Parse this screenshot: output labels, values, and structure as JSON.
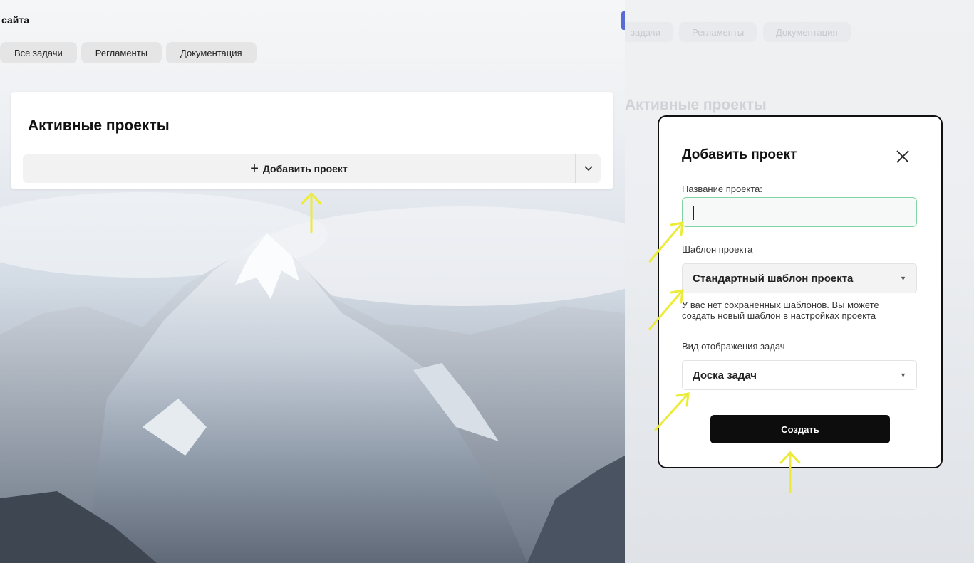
{
  "left_panel": {
    "site_label": "сайта",
    "nav_tabs": [
      "Все задачи",
      "Регламенты",
      "Документация"
    ],
    "card_title": "Активные проекты",
    "add_project_label": "Добавить проект"
  },
  "right_panel": {
    "background_tabs": [
      "задачи",
      "Регламенты",
      "Документация"
    ],
    "background_title": "Активные проекты",
    "modal": {
      "title": "Добавить проект",
      "name_label": "Название проекта:",
      "name_value": "",
      "template_label": "Шаблон проекта",
      "template_value": "Стандартный шаблон проекта",
      "template_hint": "У вас нет сохраненных шаблонов. Вы можете создать новый шаблон в настройках проекта",
      "view_label": "Вид отображения задач",
      "view_value": "Доска задач",
      "create_label": "Создать"
    }
  },
  "colors": {
    "annotation_arrow": "#ecec38",
    "modal_border": "#111111",
    "input_focus_border": "#7fd6a3",
    "create_button": "#0d0d0d",
    "accent_blue": "#5b6bd6"
  },
  "icons": [
    "plus-icon",
    "chevron-down-icon",
    "close-icon",
    "dropdown-arrow-icon"
  ]
}
